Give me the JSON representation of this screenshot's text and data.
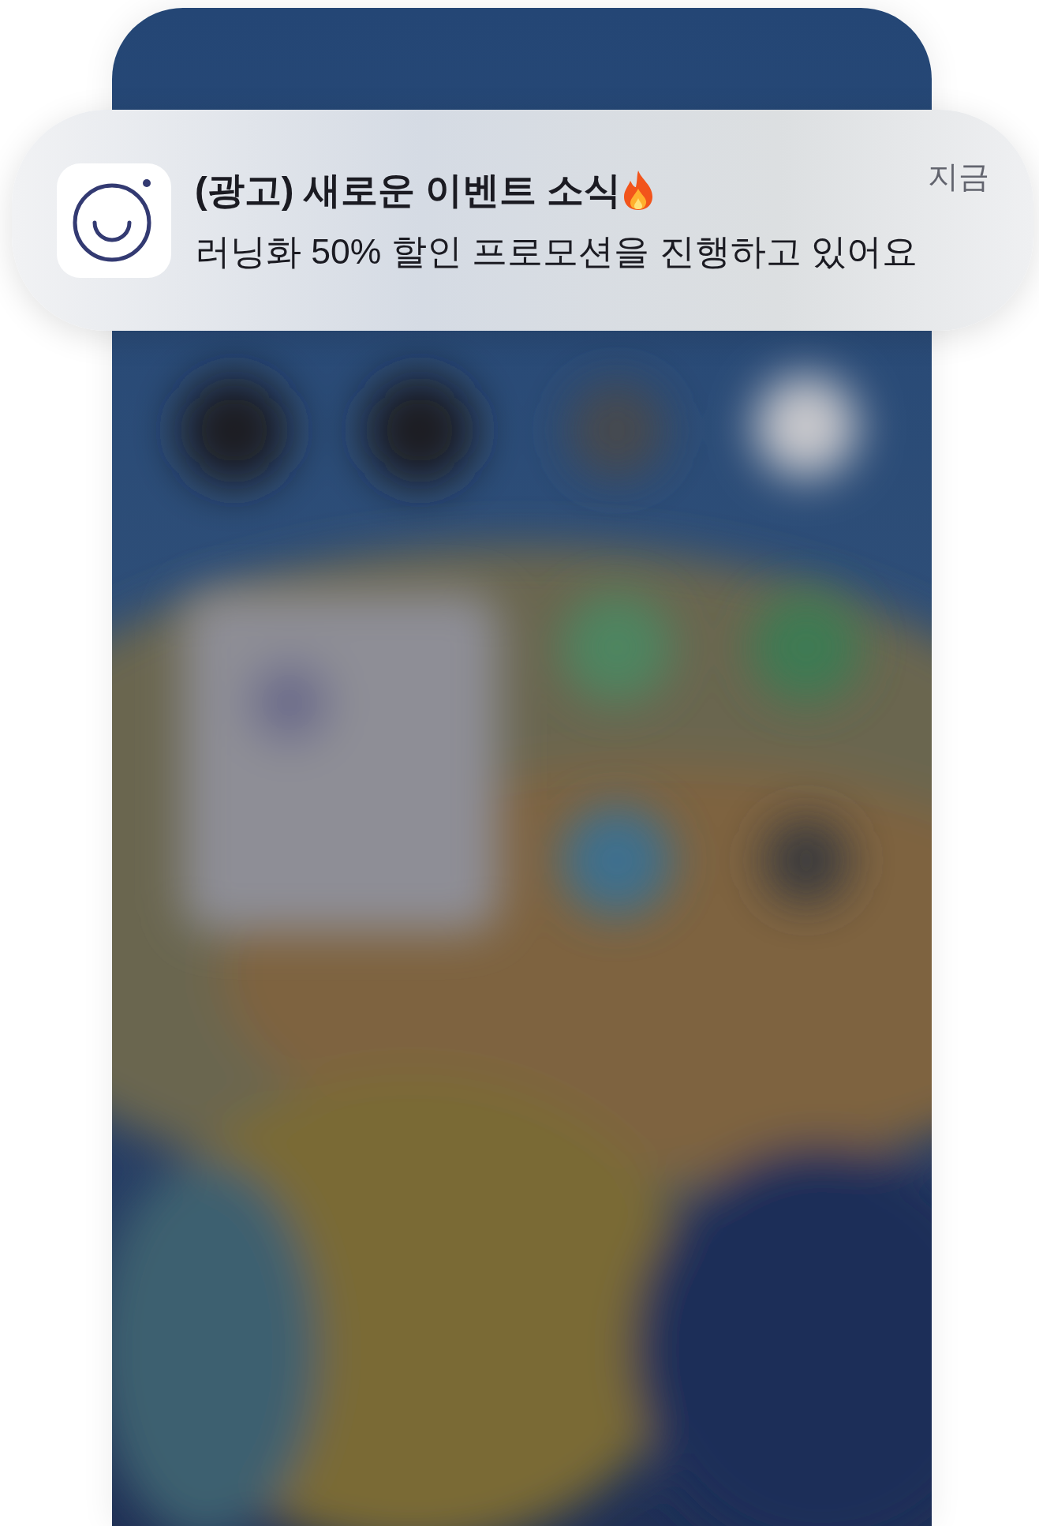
{
  "notification": {
    "title": "(광고) 새로운 이벤트 소식",
    "body": "러닝화 50% 할인 프로모션을 진행하고 있어요",
    "time": "지금"
  }
}
